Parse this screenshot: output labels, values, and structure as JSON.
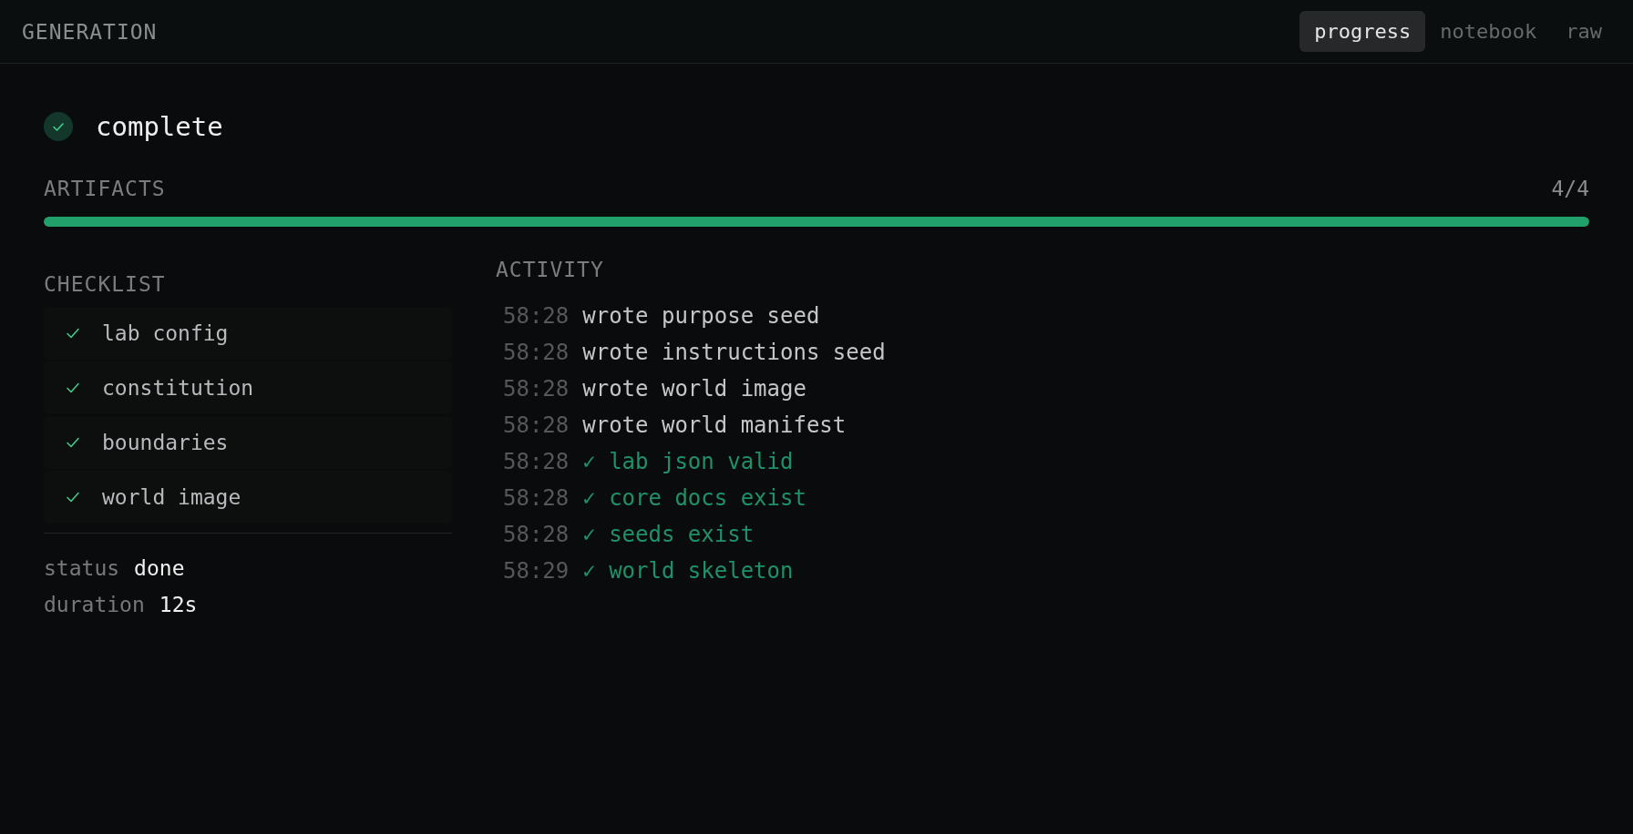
{
  "header": {
    "title": "GENERATION",
    "tabs": [
      {
        "label": "progress",
        "selected": true
      },
      {
        "label": "notebook",
        "selected": false
      },
      {
        "label": "raw",
        "selected": false
      }
    ]
  },
  "status": {
    "done": true,
    "label": "complete"
  },
  "artifacts": {
    "title": "ARTIFACTS",
    "count": "4/4",
    "level": 1
  },
  "checklist": {
    "title": "CHECKLIST",
    "items": [
      {
        "label": "lab config",
        "checked": true
      },
      {
        "label": "constitution",
        "checked": true
      },
      {
        "label": "boundaries",
        "checked": true
      },
      {
        "label": "world image",
        "checked": true
      }
    ]
  },
  "details": [
    {
      "label": "status",
      "value": "done"
    },
    {
      "label": "duration",
      "value": "12s"
    }
  ],
  "activity": {
    "title": "ACTIVITY",
    "entries": [
      {
        "time": "58:28",
        "kind": "write",
        "text": "wrote purpose seed"
      },
      {
        "time": "58:28",
        "kind": "write",
        "text": "wrote instructions seed"
      },
      {
        "time": "58:28",
        "kind": "write",
        "text": "wrote world image"
      },
      {
        "time": "58:28",
        "kind": "write",
        "text": "wrote world manifest"
      },
      {
        "time": "58:28",
        "kind": "check",
        "text": "✓ lab json valid"
      },
      {
        "time": "58:28",
        "kind": "check",
        "text": "✓ core docs exist"
      },
      {
        "time": "58:28",
        "kind": "check",
        "text": "✓ seeds exist"
      },
      {
        "time": "58:29",
        "kind": "check",
        "text": "✓ world skeleton"
      }
    ]
  }
}
